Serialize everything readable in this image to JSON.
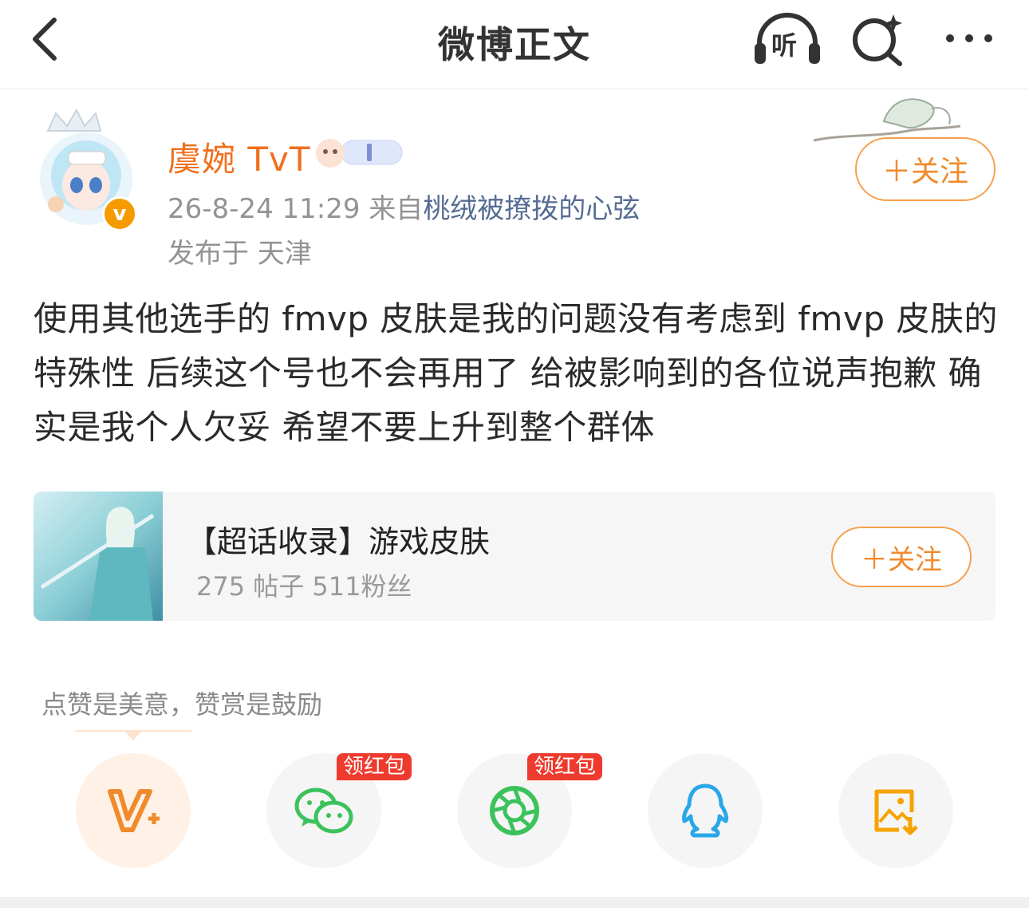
{
  "header": {
    "title": "微博正文",
    "listen_label": "听",
    "back_icon": "chevron-left-icon",
    "discover_icon": "search-sparkle-icon",
    "more_icon": "more-dots-icon"
  },
  "author": {
    "name": "虞婉 TvT",
    "verified_mark": "v",
    "date": "26-8-24 11:29",
    "source_prefix": "来自",
    "source_name": "桃绒被撩拨的心弦",
    "location": "发布于 天津",
    "follow_label": "＋关注"
  },
  "post": {
    "text": "使用其他选手的 fmvp 皮肤是我的问题没有考虑到 fmvp 皮肤的特殊性 后续这个号也不会再用了 给被影响到的各位说声抱歉 确实是我个人欠妥 希望不要上升到整个群体"
  },
  "topic": {
    "title": "【超话收录】游戏皮肤",
    "stats": "275 帖子 511粉丝",
    "follow_label": "＋关注"
  },
  "reward": {
    "hint": "点赞是美意，赞赏是鼓励",
    "redpack_label": "领红包"
  },
  "share": {
    "items": [
      {
        "icon": "vplus-icon",
        "name": "super-like"
      },
      {
        "icon": "wechat-icon",
        "name": "wechat"
      },
      {
        "icon": "moments-icon",
        "name": "wechat-moments"
      },
      {
        "icon": "qq-icon",
        "name": "qq"
      },
      {
        "icon": "save-image-icon",
        "name": "save-image"
      }
    ]
  },
  "colors": {
    "accent_orange": "#f08a2b",
    "username_orange": "#f0701e",
    "link_blue": "#566c94",
    "redpack_red": "#ee3b2e",
    "wechat_green": "#3cc25c",
    "qq_blue": "#2aa7e8",
    "save_yellow": "#f5a300"
  }
}
